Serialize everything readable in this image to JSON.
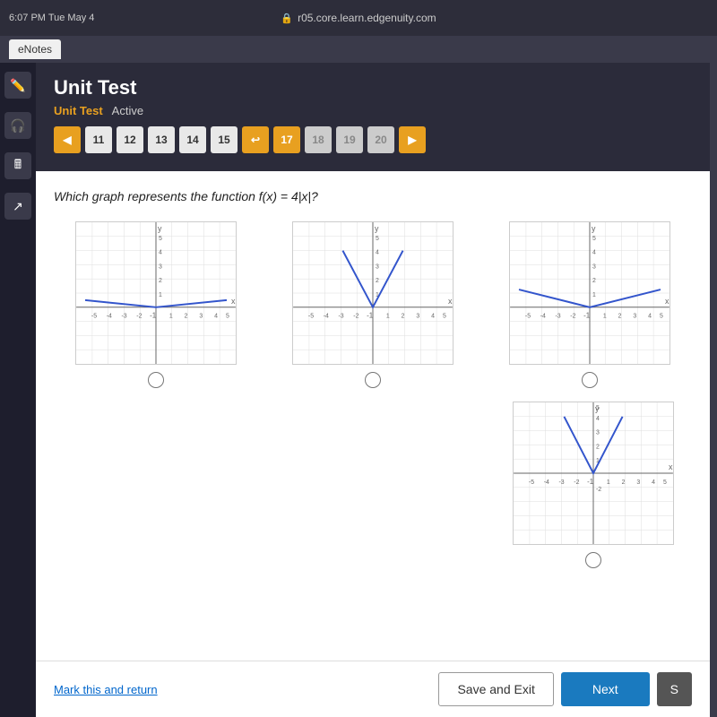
{
  "browser": {
    "time": "6:07 PM Tue May 4",
    "url": "r05.core.learn.edgenuity.com",
    "lock_icon": "🔒"
  },
  "tabs": {
    "enotes": "eNotes"
  },
  "header": {
    "page_title": "Unit Test",
    "subtitle_link": "Unit Test",
    "subtitle_status": "Active"
  },
  "nav_buttons": [
    {
      "label": "◀",
      "type": "arrow"
    },
    {
      "label": "11",
      "type": "numbered"
    },
    {
      "label": "12",
      "type": "numbered"
    },
    {
      "label": "13",
      "type": "numbered"
    },
    {
      "label": "14",
      "type": "numbered"
    },
    {
      "label": "15",
      "type": "numbered"
    },
    {
      "label": "↩",
      "type": "back-arrow"
    },
    {
      "label": "17",
      "type": "active"
    },
    {
      "label": "18",
      "type": "disabled"
    },
    {
      "label": "19",
      "type": "disabled"
    },
    {
      "label": "20",
      "type": "disabled"
    },
    {
      "label": "▶",
      "type": "arrow"
    }
  ],
  "question": {
    "text": "Which graph represents the function f(x) = 4|x|?"
  },
  "graphs": [
    {
      "id": "graph-a",
      "type": "wide_v_flat",
      "description": "V-shape opening wide, nearly flat"
    },
    {
      "id": "graph-b",
      "type": "narrow_v",
      "description": "V-shape opening upward steeply"
    },
    {
      "id": "graph-c",
      "type": "wide_v",
      "description": "V-shape opening upward wide"
    },
    {
      "id": "graph-d",
      "type": "narrow_v_shifted",
      "description": "V-shape opening upward steep, bottom right quadrant"
    }
  ],
  "sidebar": {
    "icons": [
      "✏️",
      "🎧",
      "📊",
      "📐"
    ]
  },
  "toolbar": {
    "mark_return": "Mark this and return",
    "save_exit": "Save and Exit",
    "next": "Next",
    "s_label": "S"
  }
}
